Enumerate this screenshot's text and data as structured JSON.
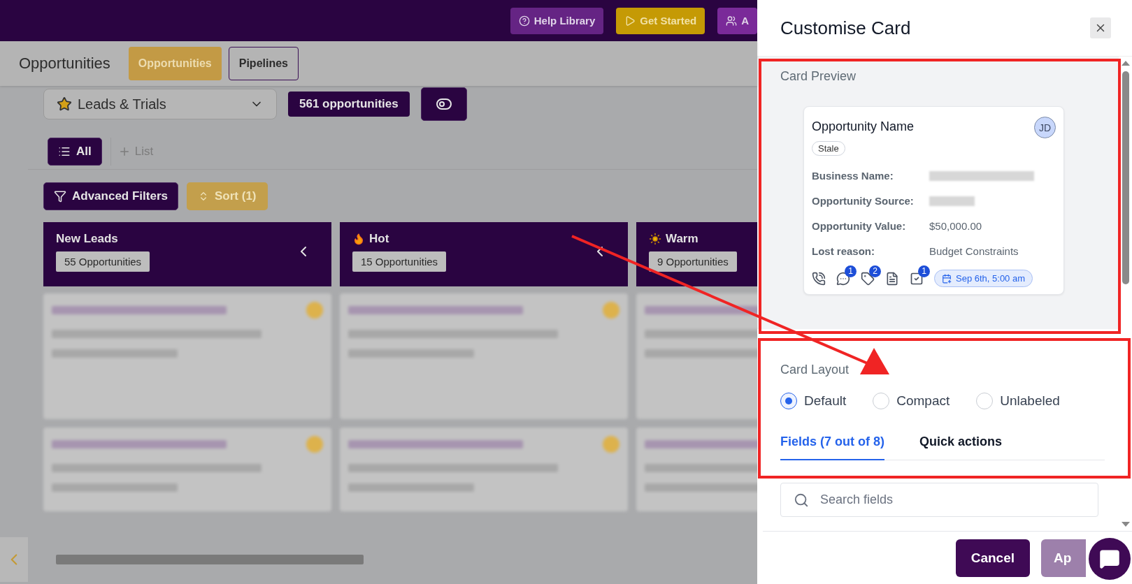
{
  "top_bar": {
    "buttons": [
      {
        "label": "Help Library",
        "kind": "help"
      },
      {
        "label": "Get Started",
        "kind": "start"
      },
      {
        "label": "A",
        "kind": "team"
      }
    ]
  },
  "header": {
    "title": "Opportunities",
    "tabs": [
      {
        "label": "Opportunities",
        "selected": true
      },
      {
        "label": "Pipelines",
        "selected": false
      }
    ]
  },
  "pipeline": {
    "name": "Leads & Trials",
    "count": "561 opportunities"
  },
  "lists": {
    "items": [
      {
        "label": "All",
        "selected": true
      }
    ],
    "add_label": "List"
  },
  "filters": [
    {
      "label": "Advanced Filters",
      "kind": "filter"
    },
    {
      "label": "Sort (1)",
      "kind": "sort"
    }
  ],
  "stages": [
    {
      "name": "New Leads",
      "count": "55 Opportunities",
      "collapse_button": true
    },
    {
      "name": "Hot",
      "count": "15 Opportunities",
      "collapse_button": true
    },
    {
      "name": "Warm",
      "count": "9 Opportunities",
      "collapse_button": false
    }
  ],
  "panel": {
    "title": "Customise Card",
    "preview": {
      "heading": "Card Preview",
      "card": {
        "title": "Opportunity Name",
        "avatar": "JD",
        "tag": "Stale",
        "fields": [
          {
            "label": "Business Name:",
            "redacted": true
          },
          {
            "label": "Opportunity Source:",
            "redacted": true
          },
          {
            "label": "Opportunity Value:",
            "value": "$50,000.00",
            "redacted": false
          },
          {
            "label": "Lost reason:",
            "value": "Budget Constraints",
            "redacted": false
          }
        ],
        "actions": [
          {
            "kind": "call"
          },
          {
            "kind": "message",
            "count": "1"
          },
          {
            "kind": "tag",
            "count": "2"
          },
          {
            "kind": "note"
          },
          {
            "kind": "task",
            "count": "1"
          }
        ],
        "date": "Sep 6th, 5:00 am"
      }
    },
    "layout": {
      "heading": "Card Layout",
      "options": [
        {
          "label": "Default",
          "selected": true
        },
        {
          "label": "Compact",
          "selected": false
        },
        {
          "label": "Unlabeled",
          "selected": false
        }
      ]
    },
    "tabs": [
      {
        "label": "Fields (7 out of 8)",
        "selected": true
      },
      {
        "label": "Quick actions",
        "selected": false
      }
    ],
    "search": {
      "placeholder": "Search fields"
    },
    "footer_buttons": [
      {
        "label": "Cancel",
        "kind": "secondary"
      },
      {
        "label": "Ap",
        "kind": "primary"
      }
    ]
  }
}
